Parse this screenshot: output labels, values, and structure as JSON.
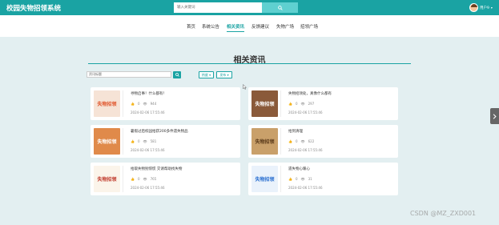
{
  "header": {
    "brand": "校园失物招领系统",
    "search_placeholder": "输入关键词",
    "username": "用户9"
  },
  "nav": {
    "items": [
      {
        "label": "首页"
      },
      {
        "label": "系统公告"
      },
      {
        "label": "相关资讯"
      },
      {
        "label": "反馈建议"
      },
      {
        "label": "失物广场"
      },
      {
        "label": "招领广场"
      }
    ],
    "active": "相关资讯"
  },
  "page": {
    "title": "相关资讯",
    "filter_placeholder": "资讯标题",
    "sort_buttons": [
      {
        "label": "热度 ▾"
      },
      {
        "label": "发布 ▾"
      }
    ]
  },
  "cards": [
    {
      "title": "寻物启事！什么都有！",
      "likes": "0",
      "views": "944",
      "date": "2024-02-06 17:55:46",
      "thumb_text": "失物招领"
    },
    {
      "title": "失物招领处，真像什么都有",
      "likes": "0",
      "views": "297",
      "date": "2024-02-06 17:55:46",
      "thumb_text": "失物招领"
    },
    {
      "title": "暑假过后校园拾获200多件遗失物品",
      "likes": "0",
      "views": "581",
      "date": "2024-02-06 17:55:46",
      "thumb_text": "失物招领"
    },
    {
      "title": "拾到清理",
      "likes": "0",
      "views": "622",
      "date": "2024-02-06 17:55:46",
      "thumb_text": "失物招领"
    },
    {
      "title": "拾取失物别惊慌 交请帮助找失物",
      "likes": "0",
      "views": "765",
      "date": "2024-02-06 17:55:46",
      "thumb_text": "失物招领"
    },
    {
      "title": "遗失物心暖心",
      "likes": "0",
      "views": "31",
      "date": "2024-02-06 17:55:46",
      "thumb_text": "失物招领"
    }
  ],
  "watermark": "CSDN @MZ_ZXD001",
  "colors": {
    "accent": "#1aa3a3",
    "background": "#e3eff1"
  }
}
